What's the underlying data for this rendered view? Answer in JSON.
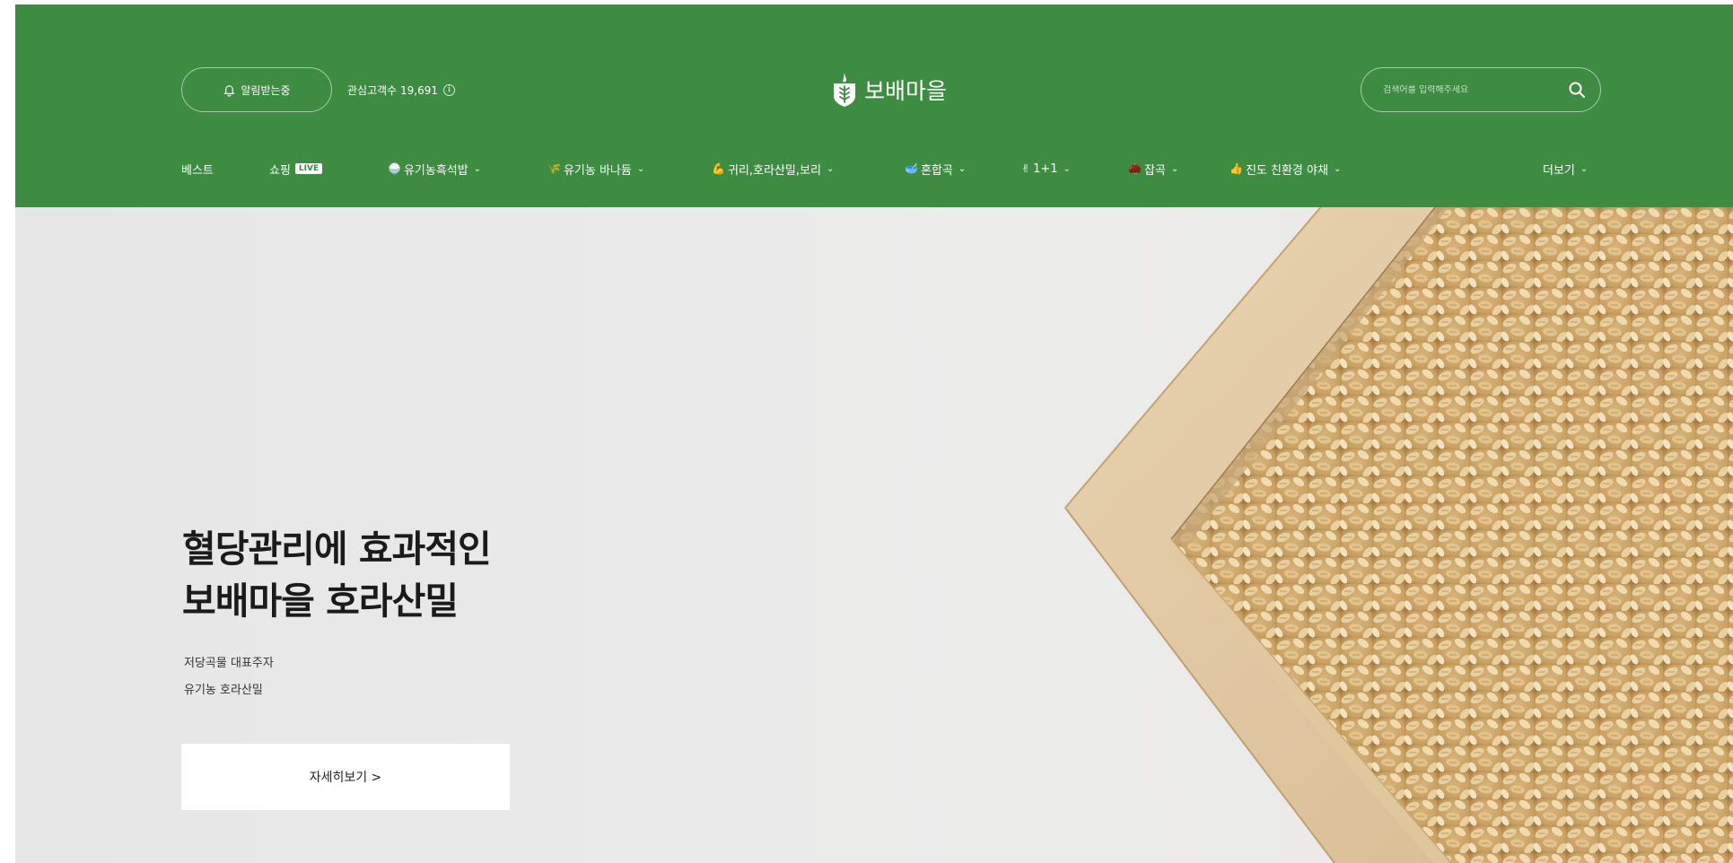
{
  "header": {
    "notify_label": "알림받는중",
    "followers_label": "관심고객수 19,691",
    "info_icon": "i",
    "logo_text": "보배마을",
    "search_placeholder": "검색어를 입력해주세요",
    "bg_color": "#3e8c42"
  },
  "nav": {
    "items": [
      {
        "emoji": "",
        "label": "베스트"
      },
      {
        "emoji": "",
        "label": "쇼핑",
        "badge": "LIVE"
      },
      {
        "emoji": "🍚",
        "label": "유기농흑석밥"
      },
      {
        "emoji": "🌾",
        "label": "유기농 바나듐"
      },
      {
        "emoji": "💪",
        "label": "귀리,호라산밀,보리"
      },
      {
        "emoji": "🥣",
        "label": "혼합곡"
      },
      {
        "emoji": "✌",
        "label": "1+1"
      },
      {
        "emoji": "🌰",
        "label": "잡곡"
      },
      {
        "emoji": "👍",
        "label": "진도 친환경 야채"
      }
    ],
    "more_label": "더보기"
  },
  "hero": {
    "title_line1": "혈당관리에 효과적인",
    "title_line2": "보배마을 호라산밀",
    "sub_line1": "저당곡물 대표주자",
    "sub_line2": "유기농 호라산밀",
    "button_label": "자세히보기 >"
  }
}
